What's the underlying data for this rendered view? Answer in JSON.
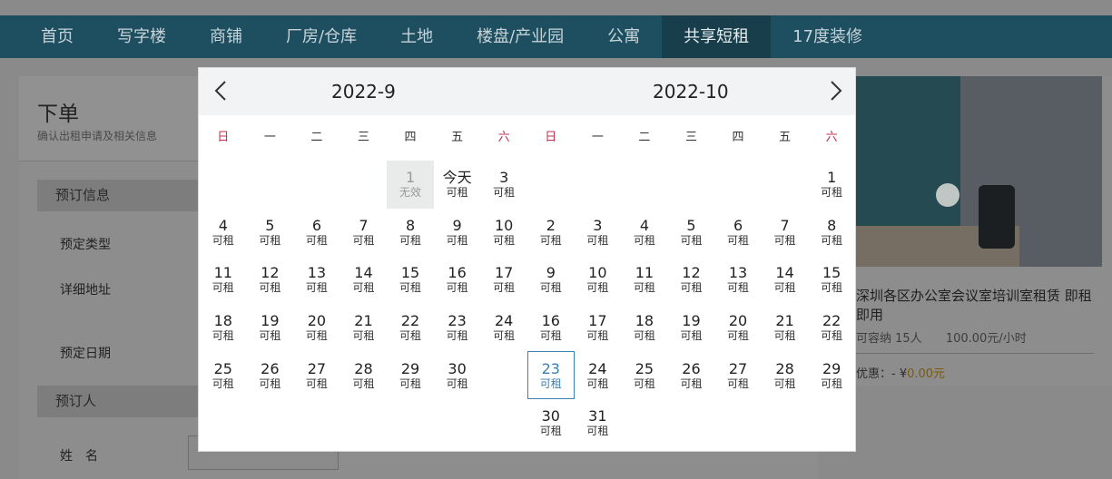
{
  "nav": {
    "items": [
      "首页",
      "写字楼",
      "商铺",
      "厂房/仓库",
      "土地",
      "楼盘/产业园",
      "公寓",
      "共享短租",
      "17度装修"
    ],
    "active_index": 7
  },
  "page": {
    "title": "下单",
    "subtitle": "确认出租申请及相关信息",
    "section_booking": "预订信息",
    "label_type": "预定类型",
    "label_address": "详细地址",
    "label_date": "预定日期",
    "section_person": "预订人",
    "label_name": "姓　名"
  },
  "card": {
    "title": "深圳各区办公室会议室培训室租赁 即租即用",
    "capacity": "可容纳 15人",
    "price": "100.00元/小时",
    "promo_label": "优惠：- ¥",
    "promo_amount": "0.00元"
  },
  "calendar": {
    "prev_icon": "chevron-left-icon",
    "next_icon": "chevron-right-icon",
    "weekdays": [
      "日",
      "一",
      "二",
      "三",
      "四",
      "五",
      "六"
    ],
    "weekend_color": "#c0304c",
    "selected_color": "#3a7fae",
    "months": [
      {
        "title": "2022-9",
        "days": [
          {
            "n": ""
          },
          {
            "n": ""
          },
          {
            "n": ""
          },
          {
            "n": ""
          },
          {
            "n": "1",
            "s": "无效",
            "state": "disabled"
          },
          {
            "n": "今天",
            "s": "可租",
            "state": "today"
          },
          {
            "n": "3",
            "s": "可租"
          },
          {
            "n": "4",
            "s": "可租"
          },
          {
            "n": "5",
            "s": "可租"
          },
          {
            "n": "6",
            "s": "可租"
          },
          {
            "n": "7",
            "s": "可租"
          },
          {
            "n": "8",
            "s": "可租"
          },
          {
            "n": "9",
            "s": "可租"
          },
          {
            "n": "10",
            "s": "可租"
          },
          {
            "n": "11",
            "s": "可租"
          },
          {
            "n": "12",
            "s": "可租"
          },
          {
            "n": "13",
            "s": "可租"
          },
          {
            "n": "14",
            "s": "可租"
          },
          {
            "n": "15",
            "s": "可租"
          },
          {
            "n": "16",
            "s": "可租"
          },
          {
            "n": "17",
            "s": "可租"
          },
          {
            "n": "18",
            "s": "可租"
          },
          {
            "n": "19",
            "s": "可租"
          },
          {
            "n": "20",
            "s": "可租"
          },
          {
            "n": "21",
            "s": "可租"
          },
          {
            "n": "22",
            "s": "可租"
          },
          {
            "n": "23",
            "s": "可租"
          },
          {
            "n": "24",
            "s": "可租"
          },
          {
            "n": "25",
            "s": "可租"
          },
          {
            "n": "26",
            "s": "可租"
          },
          {
            "n": "27",
            "s": "可租"
          },
          {
            "n": "28",
            "s": "可租"
          },
          {
            "n": "29",
            "s": "可租"
          },
          {
            "n": "30",
            "s": "可租"
          }
        ]
      },
      {
        "title": "2022-10",
        "days": [
          {
            "n": ""
          },
          {
            "n": ""
          },
          {
            "n": ""
          },
          {
            "n": ""
          },
          {
            "n": ""
          },
          {
            "n": ""
          },
          {
            "n": "1",
            "s": "可租"
          },
          {
            "n": "2",
            "s": "可租"
          },
          {
            "n": "3",
            "s": "可租"
          },
          {
            "n": "4",
            "s": "可租"
          },
          {
            "n": "5",
            "s": "可租"
          },
          {
            "n": "6",
            "s": "可租"
          },
          {
            "n": "7",
            "s": "可租"
          },
          {
            "n": "8",
            "s": "可租"
          },
          {
            "n": "9",
            "s": "可租"
          },
          {
            "n": "10",
            "s": "可租"
          },
          {
            "n": "11",
            "s": "可租"
          },
          {
            "n": "12",
            "s": "可租"
          },
          {
            "n": "13",
            "s": "可租"
          },
          {
            "n": "14",
            "s": "可租"
          },
          {
            "n": "15",
            "s": "可租"
          },
          {
            "n": "16",
            "s": "可租"
          },
          {
            "n": "17",
            "s": "可租"
          },
          {
            "n": "18",
            "s": "可租"
          },
          {
            "n": "19",
            "s": "可租"
          },
          {
            "n": "20",
            "s": "可租"
          },
          {
            "n": "21",
            "s": "可租"
          },
          {
            "n": "22",
            "s": "可租"
          },
          {
            "n": "23",
            "s": "可租",
            "state": "selected"
          },
          {
            "n": "24",
            "s": "可租"
          },
          {
            "n": "25",
            "s": "可租"
          },
          {
            "n": "26",
            "s": "可租"
          },
          {
            "n": "27",
            "s": "可租"
          },
          {
            "n": "28",
            "s": "可租"
          },
          {
            "n": "29",
            "s": "可租"
          },
          {
            "n": "30",
            "s": "可租"
          },
          {
            "n": "31",
            "s": "可租"
          }
        ]
      }
    ]
  }
}
